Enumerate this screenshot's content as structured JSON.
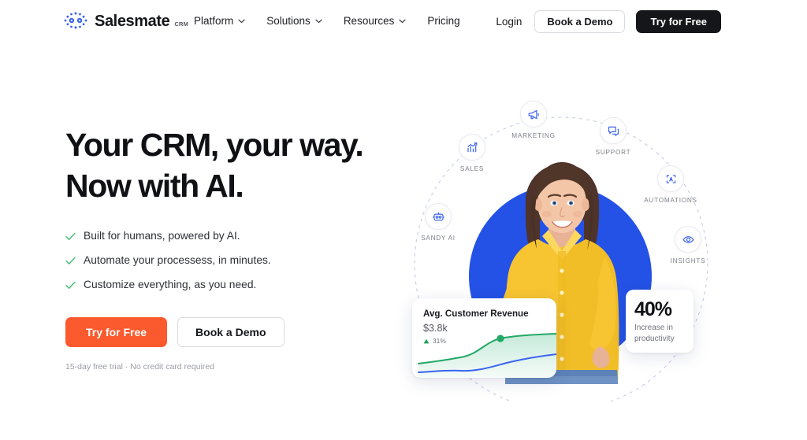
{
  "header": {
    "brand": {
      "name": "Salesmate",
      "superscript": "CRM",
      "logo_icon": "salesmate-logo-icon",
      "accent": "#3b63f0"
    },
    "nav": [
      {
        "label": "Platform",
        "has_dropdown": true,
        "icon": "chevron-down-icon"
      },
      {
        "label": "Solutions",
        "has_dropdown": true,
        "icon": "chevron-down-icon"
      },
      {
        "label": "Resources",
        "has_dropdown": true,
        "icon": "chevron-down-icon"
      },
      {
        "label": "Pricing",
        "has_dropdown": false
      }
    ],
    "login_label": "Login",
    "demo_label": "Book a Demo",
    "trial_label": "Try for Free"
  },
  "hero": {
    "headline_line1": "Your CRM, your way.",
    "headline_line2": "Now with AI.",
    "bullets": [
      {
        "icon": "check-icon",
        "text": "Built for humans, powered by AI."
      },
      {
        "icon": "check-icon",
        "text": "Automate your processess, in minutes."
      },
      {
        "icon": "check-icon",
        "text": "Customize everything, as you need."
      }
    ],
    "primary_cta": "Try for Free",
    "secondary_cta": "Book a Demo",
    "fineprint": "15-day free trial · No credit card required",
    "colors": {
      "primary": "#fb5a2e",
      "check": "#4cbf7d",
      "blue": "#2452e6"
    }
  },
  "orbit": {
    "nodes": [
      {
        "label": "MARKETING",
        "icon": "megaphone-icon"
      },
      {
        "label": "SUPPORT",
        "icon": "chat-bubbles-icon"
      },
      {
        "label": "AUTOMATIONS",
        "icon": "automation-loop-icon"
      },
      {
        "label": "INSIGHTS",
        "icon": "eye-icon"
      },
      {
        "label": "SANDY AI",
        "icon": "robot-icon"
      },
      {
        "label": "SALES",
        "icon": "bar-chart-up-icon"
      }
    ]
  },
  "cards": {
    "revenue": {
      "title": "Avg. Customer Revenue",
      "value": "$3.8k",
      "delta": "31%",
      "delta_direction": "up",
      "delta_icon": "triangle-up-icon"
    },
    "stat": {
      "number": "40%",
      "caption_line1": "Increase in",
      "caption_line2": "productivity"
    }
  },
  "chart_data": {
    "type": "area",
    "title": "Avg. Customer Revenue",
    "x": [
      0,
      1,
      2,
      3,
      4,
      5,
      6,
      7,
      8
    ],
    "series": [
      {
        "name": "revenue-green",
        "color": "#23a866",
        "values": [
          22,
          25,
          28,
          33,
          44,
          56,
          63,
          66,
          67
        ],
        "marker_at_index": 5
      },
      {
        "name": "baseline-blue",
        "color": "#3b63f0",
        "values": [
          10,
          11,
          11,
          12,
          15,
          21,
          28,
          33,
          36
        ]
      }
    ],
    "ylim": [
      0,
      75
    ],
    "grid": false,
    "legend": "none"
  }
}
